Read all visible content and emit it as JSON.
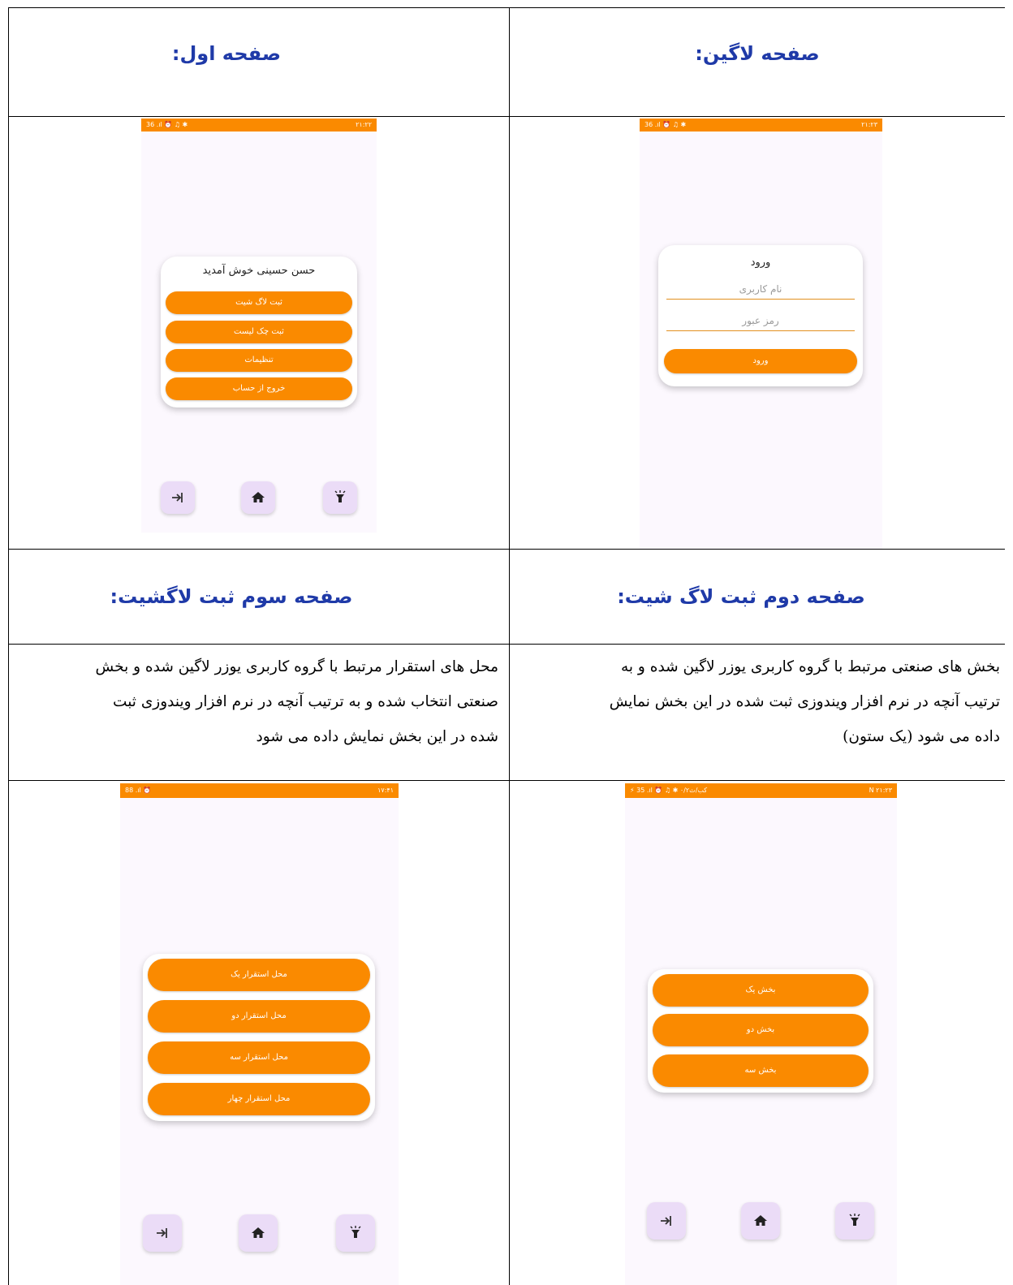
{
  "headers": {
    "login": "صفحه لاگین:",
    "first": "صفحه اول:",
    "second": "صفحه دوم ثبت لاگ شیت:",
    "third": "صفحه سوم ثبت لاگشیت:"
  },
  "descriptions": {
    "second": [
      "بخش های صنعتی  مرتبط با گروه کاربری یوزر لاگین شده و به",
      "ترتیب آنچه در نرم افزار ویندوزی ثبت شده در این بخش نمایش",
      "داده می شود (یک ستون)"
    ],
    "third": [
      "محل های استقرار مرتبط با گروه کاربری یوزر لاگین شده و بخش",
      "صنعتی انتخاب شده و به ترتیب آنچه در نرم افزار ویندوزی ثبت",
      "شده در این بخش نمایش داده می شود"
    ]
  },
  "status_bars": {
    "first": {
      "left": "36 .ıl ⏰ ♫ ✱",
      "right": "۲۱:۲۲"
    },
    "login": {
      "left": "36 .ıl ⏰ ♫ ✱",
      "right": "۲۱:۲۳"
    },
    "second": {
      "left": "⚡ 35 .ıl ⏰ ♫ ✱ ۰/۲کب/ث",
      "right": "N ۲۱:۲۳"
    },
    "third": {
      "left": "88 .ıl ⏰",
      "right": "۱۷:۴۱"
    }
  },
  "login_screen": {
    "title": "ورود",
    "username_placeholder": "نام کاربری",
    "password_placeholder": "رمز عبور",
    "submit_label": "ورود"
  },
  "first_screen": {
    "welcome": "حسن حسینی خوش آمدید",
    "buttons": [
      "ثبت لاگ شیت",
      "ثبت چک لیست",
      "تنظیمات",
      "خروج از حساب"
    ]
  },
  "second_screen": {
    "buttons": [
      "بخش یک",
      "بخش دو",
      "بخش سه"
    ]
  },
  "third_screen": {
    "buttons": [
      "محل استقرار یک",
      "محل استقرار دو",
      "محل استقرار سه",
      "محل استقرار چهار"
    ]
  },
  "nav_icons": [
    "login-icon",
    "home-icon",
    "flashlight-icon"
  ],
  "colors": {
    "accent": "#fa8a00",
    "header_text": "#1f3aa8",
    "phone_bg": "#fcf8fe",
    "nav_button": "#ebdcf7"
  }
}
